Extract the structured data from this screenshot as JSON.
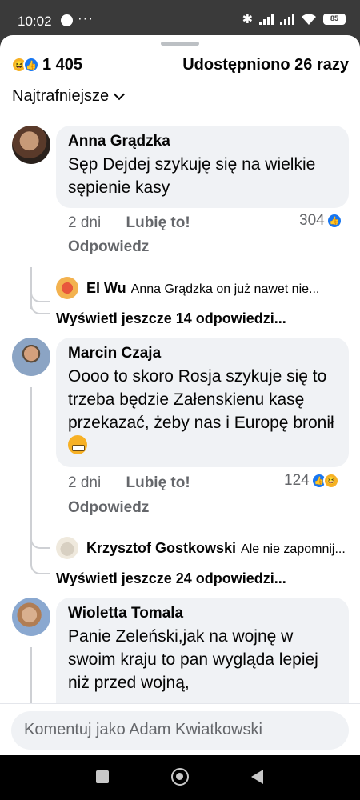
{
  "status_bar": {
    "time": "10:02",
    "dots": "···",
    "battery": "85"
  },
  "header": {
    "reaction_count": "1 405",
    "shares": "Udostępniono 26 razy"
  },
  "sort": {
    "label": "Najtrafniejsze"
  },
  "comments": [
    {
      "name": "Anna Grądzka",
      "text": "Sęp Dejdej szykuję się na wielkie sępienie kasy",
      "age": "2 dni",
      "like_label": "Lubię to!",
      "reply_label": "Odpowiedz",
      "reaction_count": "304",
      "reply_preview": {
        "name": "El Wu",
        "text": "Anna Grądzka on już nawet nie..."
      },
      "more_replies": "Wyświetl jeszcze 14 odpowiedzi..."
    },
    {
      "name": "Marcin Czaja",
      "text": "Oooo to skoro Rosja szykuje się to trzeba będzie Załenskienu  kasę przekazać, żeby nas i Europę bronił",
      "age": "2 dni",
      "like_label": "Lubię to!",
      "reply_label": "Odpowiedz",
      "reaction_count": "124",
      "reply_preview": {
        "name": "Krzysztof Gostkowski",
        "text": "Ale nie zapomnij..."
      },
      "more_replies": "Wyświetl jeszcze 24 odpowiedzi..."
    },
    {
      "name": "Wioletta Tomala",
      "text": "Panie Zeleński,jak na wojnę w swoim kraju to pan wygląda lepiej niż przed wojną,"
    }
  ],
  "composer": {
    "placeholder": "Komentuj jako Adam Kwiatkowski"
  },
  "icons": {
    "haha": "grinning-face",
    "like": "thumbs-up",
    "chevron": "chevron-down"
  },
  "colors": {
    "like_blue": "#1877f2",
    "haha_yellow": "#f7b125",
    "muted_text": "#65676b",
    "bubble": "#f0f2f5"
  }
}
